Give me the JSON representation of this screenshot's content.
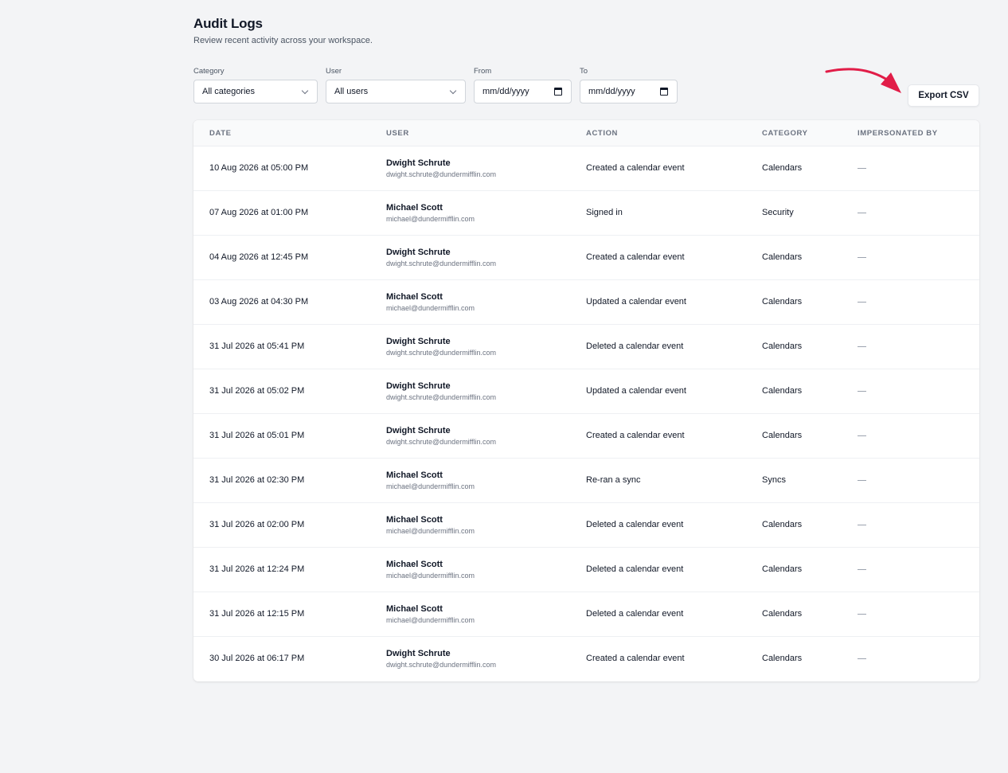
{
  "header": {
    "title": "Audit Logs",
    "subtitle": "Review recent activity across your workspace."
  },
  "filters": {
    "category": {
      "label": "Category",
      "value": "All categories"
    },
    "user": {
      "label": "User",
      "value": "All users"
    },
    "from": {
      "label": "From",
      "value": "mm/dd/yyyy"
    },
    "to": {
      "label": "To",
      "value": "mm/dd/yyyy"
    }
  },
  "actions": {
    "export_label": "Export CSV"
  },
  "table": {
    "columns": [
      "DATE",
      "USER",
      "ACTION",
      "CATEGORY",
      "IMPERSONATED BY"
    ],
    "rows": [
      {
        "date": "10 Aug 2026 at 05:00 PM",
        "user_name": "Dwight Schrute",
        "user_email": "dwight.schrute@dundermifflin.com",
        "action": "Created a calendar event",
        "category": "Calendars",
        "impersonated_by": ""
      },
      {
        "date": "07 Aug 2026 at 01:00 PM",
        "user_name": "Michael Scott",
        "user_email": "michael@dundermifflin.com",
        "action": "Signed in",
        "category": "Security",
        "impersonated_by": ""
      },
      {
        "date": "04 Aug 2026 at 12:45 PM",
        "user_name": "Dwight Schrute",
        "user_email": "dwight.schrute@dundermifflin.com",
        "action": "Created a calendar event",
        "category": "Calendars",
        "impersonated_by": ""
      },
      {
        "date": "03 Aug 2026 at 04:30 PM",
        "user_name": "Michael Scott",
        "user_email": "michael@dundermifflin.com",
        "action": "Updated a calendar event",
        "category": "Calendars",
        "impersonated_by": ""
      },
      {
        "date": "31 Jul 2026 at 05:41 PM",
        "user_name": "Dwight Schrute",
        "user_email": "dwight.schrute@dundermifflin.com",
        "action": "Deleted a calendar event",
        "category": "Calendars",
        "impersonated_by": ""
      },
      {
        "date": "31 Jul 2026 at 05:02 PM",
        "user_name": "Dwight Schrute",
        "user_email": "dwight.schrute@dundermifflin.com",
        "action": "Updated a calendar event",
        "category": "Calendars",
        "impersonated_by": ""
      },
      {
        "date": "31 Jul 2026 at 05:01 PM",
        "user_name": "Dwight Schrute",
        "user_email": "dwight.schrute@dundermifflin.com",
        "action": "Created a calendar event",
        "category": "Calendars",
        "impersonated_by": ""
      },
      {
        "date": "31 Jul 2026 at 02:30 PM",
        "user_name": "Michael Scott",
        "user_email": "michael@dundermifflin.com",
        "action": "Re-ran a sync",
        "category": "Syncs",
        "impersonated_by": ""
      },
      {
        "date": "31 Jul 2026 at 02:00 PM",
        "user_name": "Michael Scott",
        "user_email": "michael@dundermifflin.com",
        "action": "Deleted a calendar event",
        "category": "Calendars",
        "impersonated_by": ""
      },
      {
        "date": "31 Jul 2026 at 12:24 PM",
        "user_name": "Michael Scott",
        "user_email": "michael@dundermifflin.com",
        "action": "Deleted a calendar event",
        "category": "Calendars",
        "impersonated_by": ""
      },
      {
        "date": "31 Jul 2026 at 12:15 PM",
        "user_name": "Michael Scott",
        "user_email": "michael@dundermifflin.com",
        "action": "Deleted a calendar event",
        "category": "Calendars",
        "impersonated_by": ""
      },
      {
        "date": "30 Jul 2026 at 06:17 PM",
        "user_name": "Dwight Schrute",
        "user_email": "dwight.schrute@dundermifflin.com",
        "action": "Created a calendar event",
        "category": "Calendars",
        "impersonated_by": ""
      }
    ]
  },
  "colors": {
    "background": "#f3f4f6",
    "annotation_arrow": "#e11d48",
    "text_primary": "#111827",
    "text_muted": "#6b7280"
  },
  "icons": {
    "select": "chevron-down-icon",
    "date": "calendar-icon",
    "annotation": "arrow-annotation-icon"
  }
}
